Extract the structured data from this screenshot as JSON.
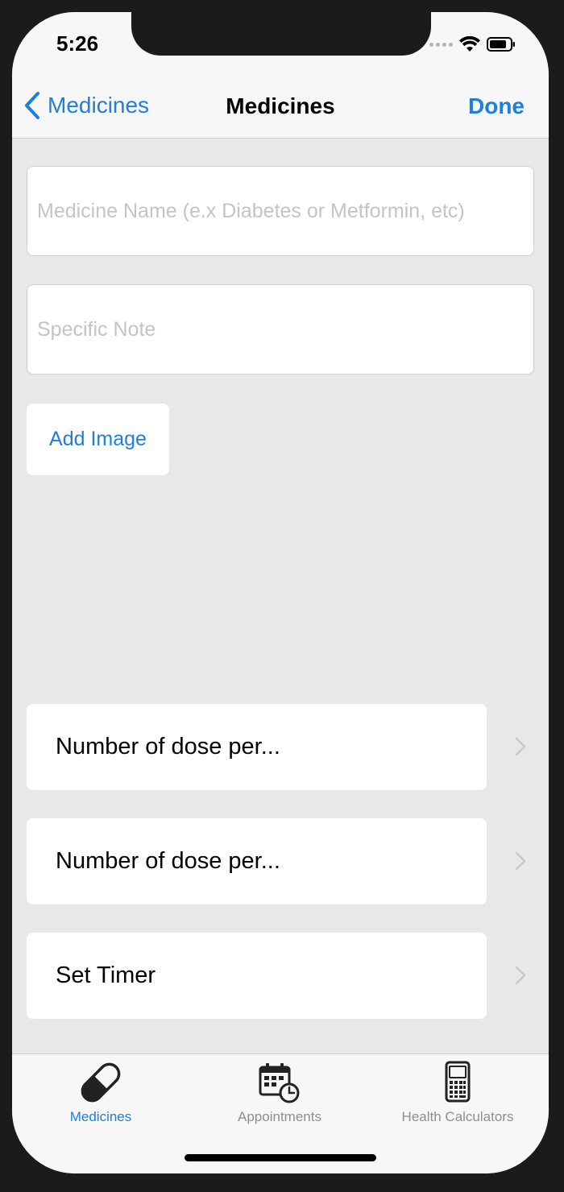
{
  "status_bar": {
    "time": "5:26"
  },
  "nav": {
    "back_label": "Medicines",
    "title": "Medicines",
    "done_label": "Done"
  },
  "form": {
    "name_placeholder": "Medicine Name (e.x Diabetes or Metformin, etc)",
    "name_value": "",
    "note_placeholder": "Specific Note",
    "note_value": "",
    "add_image_label": "Add Image"
  },
  "rows": [
    {
      "label": "Number of dose per..."
    },
    {
      "label": "Number of dose per..."
    },
    {
      "label": "Set Timer"
    }
  ],
  "tabs": [
    {
      "label": "Medicines",
      "icon": "pill-icon",
      "active": true
    },
    {
      "label": "Appointments",
      "icon": "calendar-clock-icon",
      "active": false
    },
    {
      "label": "Health Calculators",
      "icon": "calculator-icon",
      "active": false
    }
  ],
  "colors": {
    "accent": "#1d7fe0",
    "background": "#e8e8e8",
    "bar": "#f7f7f7",
    "inactive_tab": "#8e8e93"
  }
}
